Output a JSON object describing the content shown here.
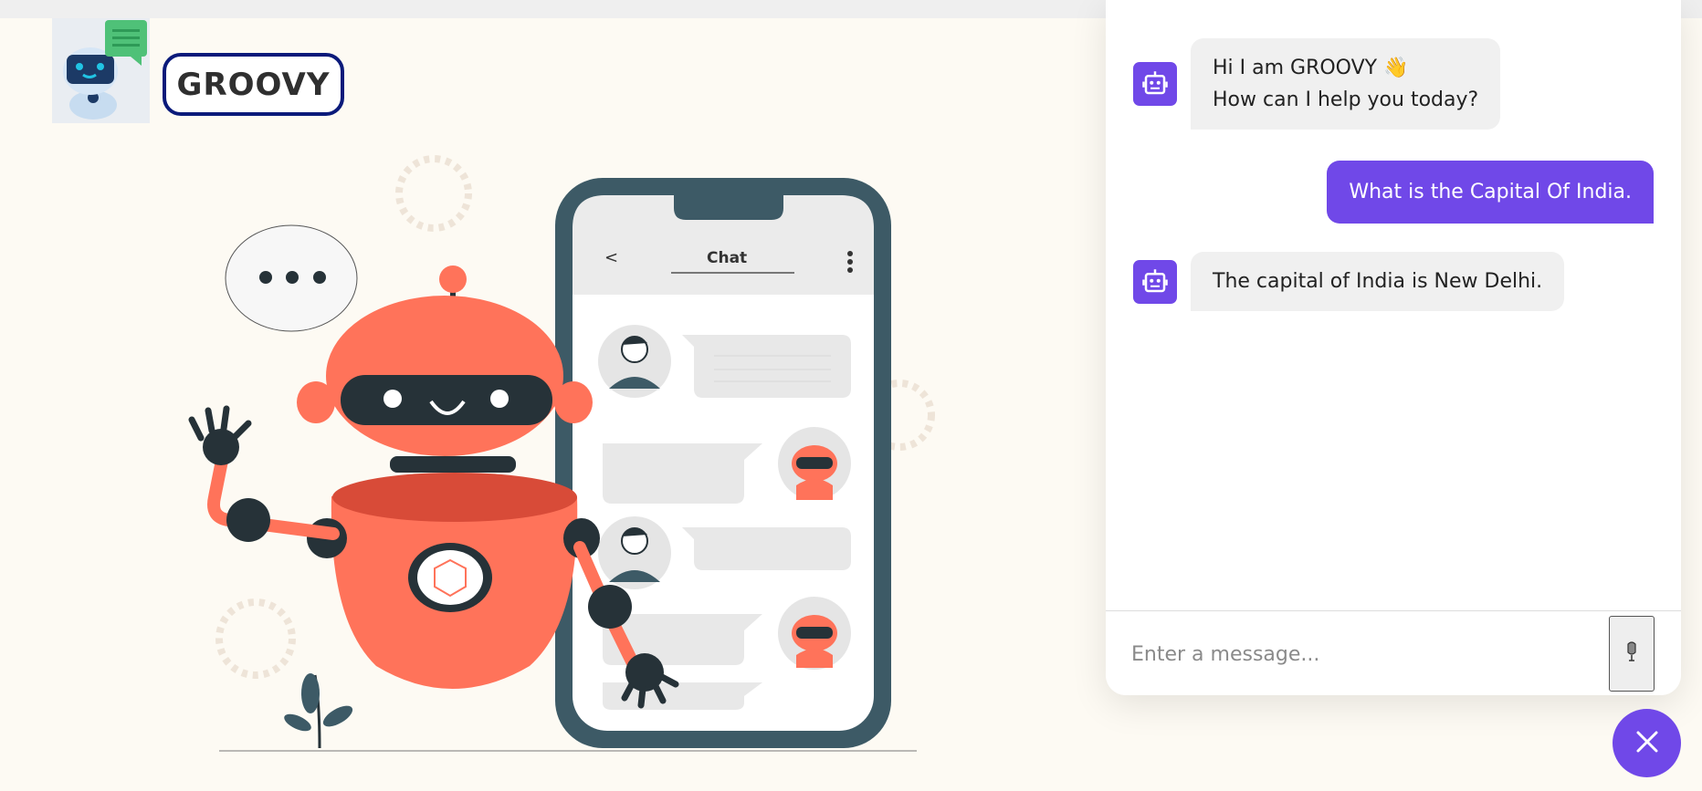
{
  "brand": {
    "name": "GROOVY"
  },
  "illustration": {
    "phone_title": "Chat",
    "back_symbol": "<",
    "icons": [
      "robot-mascot",
      "phone-mockup",
      "speech-bubble-icon",
      "kebab-menu-icon",
      "plant-icon"
    ]
  },
  "chat": {
    "messages": [
      {
        "sender": "bot",
        "lines": [
          "Hi I am GROOVY 👋",
          "How can I help you today?"
        ]
      },
      {
        "sender": "user",
        "text": "What is the Capital Of India."
      },
      {
        "sender": "bot",
        "lines": [
          "The capital of India is New Delhi."
        ]
      }
    ],
    "input": {
      "placeholder": "Enter a message...",
      "value": ""
    },
    "icons": {
      "bot_avatar": "robot-icon",
      "mic": "microphone-icon",
      "close": "close-icon"
    }
  },
  "colors": {
    "accent": "#7048e8",
    "background": "#fdfaf3",
    "bot_bubble": "#f0f0f0",
    "brand_border": "#0a1a7a",
    "robot_body": "#ff735a",
    "robot_dark": "#263238"
  }
}
